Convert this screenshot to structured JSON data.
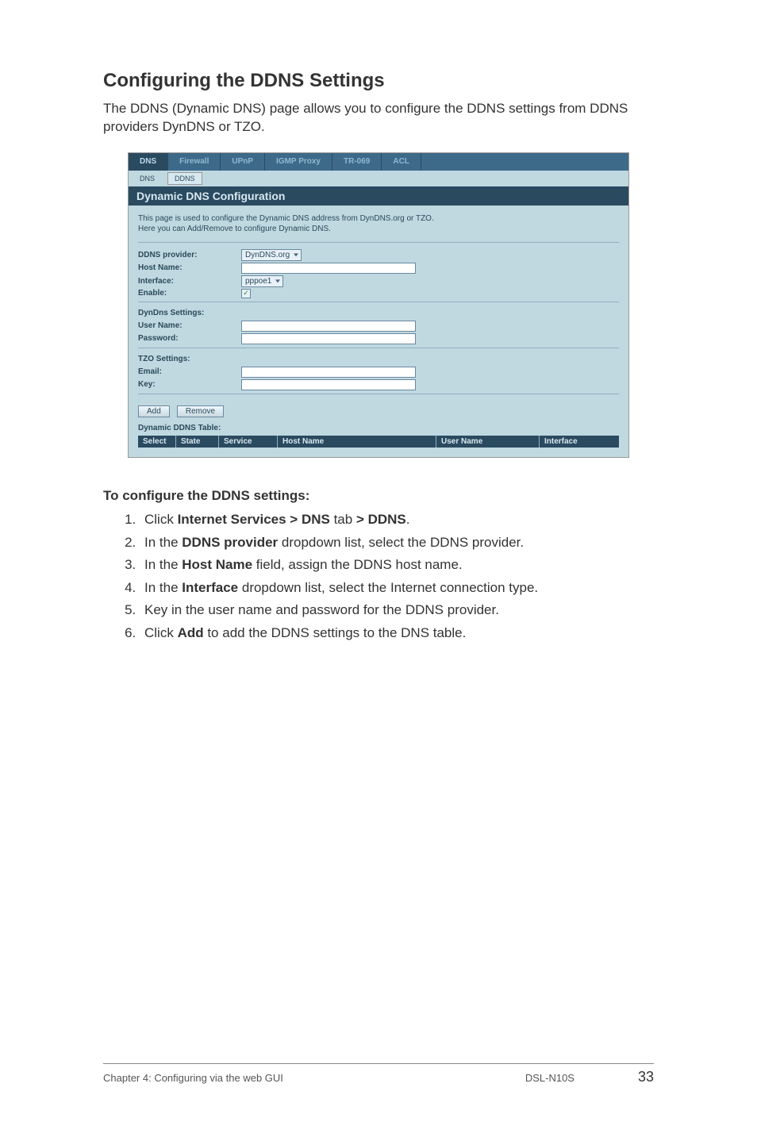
{
  "heading": "Configuring the DDNS Settings",
  "intro": "The DDNS (Dynamic DNS) page allows you to configure the DDNS settings from DDNS providers DynDNS or TZO.",
  "screenshot": {
    "main_tabs": [
      "DNS",
      "Firewall",
      "UPnP",
      "IGMP Proxy",
      "TR-069",
      "ACL"
    ],
    "main_active": "DNS",
    "sub_tabs": [
      "DNS",
      "DDNS"
    ],
    "sub_active": "DDNS",
    "panel_title": "Dynamic DNS Configuration",
    "hint_line1": "This page is used to configure the Dynamic DNS address from DynDNS.org or TZO.",
    "hint_line2": "Here you can Add/Remove to configure Dynamic DNS.",
    "fields": {
      "provider_label": "DDNS provider:",
      "provider_value": "DynDNS.org",
      "hostname_label": "Host Name:",
      "interface_label": "Interface:",
      "interface_value": "pppoe1",
      "enable_label": "Enable:"
    },
    "dyndns_heading": "DynDns Settings:",
    "dyndns": {
      "user_label": "User Name:",
      "pass_label": "Password:"
    },
    "tzo_heading": "TZO Settings:",
    "tzo": {
      "email_label": "Email:",
      "key_label": "Key:"
    },
    "buttons": {
      "add": "Add",
      "remove": "Remove"
    },
    "table_caption": "Dynamic DDNS Table:",
    "table_headers": [
      "Select",
      "State",
      "Service",
      "Host Name",
      "User Name",
      "Interface"
    ]
  },
  "instructions_heading": "To configure the DDNS settings:",
  "steps": {
    "s1_pre": "Click ",
    "s1_b1": "Internet Services > DNS",
    "s1_mid": " tab ",
    "s1_b2": "> DDNS",
    "s1_post": ".",
    "s2_pre": "In the ",
    "s2_b": "DDNS provider",
    "s2_post": " dropdown list, select the DDNS provider.",
    "s3_pre": "In the ",
    "s3_b": "Host Name",
    "s3_post": " field, assign the DDNS host name.",
    "s4_pre": "In the ",
    "s4_b": "Interface",
    "s4_post": " dropdown list, select the Internet connection type.",
    "s5": "Key in the user name and password for the DDNS provider.",
    "s6_pre": "Click ",
    "s6_b": "Add",
    "s6_post": " to add the DDNS settings to the DNS table."
  },
  "footer": {
    "left": "Chapter 4: Configuring via the web GUI",
    "model": "DSL-N10S",
    "page": "33"
  }
}
